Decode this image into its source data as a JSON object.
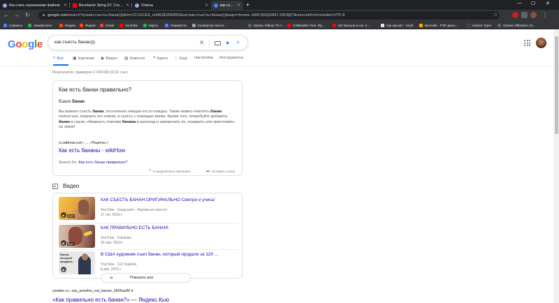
{
  "browser": {
    "tabs": [
      {
        "label": "Как слить ограничение файлов",
        "fav_color": "#8ab4f8"
      },
      {
        "label": "Benefactor String GT. Ставит на",
        "fav_color": "#ff0000"
      },
      {
        "label": "Ответы",
        "fav_color": "#8ab4f8"
      },
      {
        "label": "как съесть банан))) - Поиск в Go",
        "fav_color": "#4285f4"
      }
    ],
    "new_tab": "+",
    "window_controls": [
      "—",
      "☐",
      "✕"
    ],
    "url_host": "google.com",
    "url_rest": "/search?q=как+съесть+банан)))&rlz=1C1GCEA_enRE862RE862&oq=как+съесть+банан)))&aqs=chrome..69i57j0l2j0i30l7.2653j0j7&sourceid=chrome&ie=UTF-8",
    "bookmarks": [
      {
        "label": "Сервисы",
        "color": "#4285f4"
      },
      {
        "label": "Авиабилеты",
        "color": "#34a853"
      },
      {
        "label": "Яндекс",
        "color": "#fc3f1d"
      },
      {
        "label": "Яндекс",
        "color": "#fc3f1d"
      },
      {
        "label": "Gmail",
        "color": "#ea4335"
      },
      {
        "label": "YouTube",
        "color": "#ff0000"
      },
      {
        "label": "Карты",
        "color": "#34a853"
      },
      {
        "label": "Перевести",
        "color": "#4285f4"
      },
      {
        "label": "Конвертер тексто...",
        "color": "#9aa0a6"
      },
      {
        "label": "Купить Fallout 76 n...",
        "color": "#5f6368"
      },
      {
        "label": "Celldweller Feat. Sly...",
        "color": "#ff0000"
      },
      {
        "label": "Кот Бальни и хоз. 2...",
        "color": "#ff0000"
      },
      {
        "label": "Где маска? - Клуб",
        "color": "#e8eaed"
      },
      {
        "label": "Битлэйн - РЭР дены...",
        "color": "#f9ab00"
      },
      {
        "label": "Hacker Typer",
        "color": "#202124"
      },
      {
        "label": "Classic Offensive | B...",
        "color": "#5f6368"
      }
    ]
  },
  "google": {
    "logo": "Google",
    "query": "как съесть банан)))",
    "tabs": [
      {
        "label": "Все",
        "icon": "🔍"
      },
      {
        "label": "Картинки",
        "icon": "▣"
      },
      {
        "label": "Видео",
        "icon": "▶"
      },
      {
        "label": "Новости",
        "icon": "▤"
      },
      {
        "label": "Карты",
        "icon": "⌖"
      },
      {
        "label": "Ещё",
        "icon": "⋮"
      },
      {
        "label": "Настройки",
        "icon": ""
      },
      {
        "label": "Инструменты",
        "icon": ""
      }
    ],
    "stats": "Результатов: примерно 2 450 000 (0,62 сек.)",
    "snippet": {
      "title": "Как есть банан правильно?",
      "answer_prefix": "Ешьте ",
      "answer_bold": "банан",
      "answer_suffix": ".",
      "body": [
        {
          "t": "Вы можете съесть ",
          "b": false
        },
        {
          "t": "банан",
          "b": true
        },
        {
          "t": ", постепенно очищая его от кожуры. Также можно очистить ",
          "b": false
        },
        {
          "t": "банан",
          "b": true
        },
        {
          "t": " полностью, порезать его ножом, и съесть с помощью вилки. Кроме того, попробуйте добавить ",
          "b": false
        },
        {
          "t": "банан",
          "b": true
        },
        {
          "t": " в смузи, обмакнуть ломтики ",
          "b": false
        },
        {
          "t": "банана",
          "b": true
        },
        {
          "t": " в шоколад и заморозить их, пожарить или приготовить на гриле!",
          "b": false
        }
      ],
      "source": "ru.wikihow.com › ... › Рецепты",
      "source_more": "▾",
      "link": "Как есть бананы - wikiHow",
      "search_for_label": "Search for: ",
      "search_for_link": "Как есть банан правильно?"
    },
    "feedback": [
      {
        "label": "О выделенных описаниях",
        "icon": "?"
      },
      {
        "label": "Оставить отзыв",
        "icon": "▬"
      }
    ],
    "video_section": {
      "title": "Видео",
      "items": [
        {
          "title": "КАК СЪЕСТЬ БАНАН ОРИГИНАЛЬНО Смотри и учись!",
          "meta1": "YouTube · EasyLearn - Научиться просто!",
          "meta2": "17 окт. 2016 г.",
          "duration": "2:47"
        },
        {
          "title": "КАК ПРАВИЛЬНО ЕСТЬ БАНАН!",
          "meta1": "YouTube · Fairykiss",
          "meta2": "30 янв. 2019 г.",
          "duration": "0:17"
        },
        {
          "title": "В США художник съел банан, который продали за 120 ...",
          "meta1": "YouTube · 112 Україна",
          "meta2": "8 дек. 2019 г.",
          "duration": "",
          "thumb_text": "Банан, который продали..."
        }
      ],
      "show_all": "Показать все"
    },
    "next_result": {
      "url": "yandex.ru › как_pravilno_est_banan_0b56ae86 ▾",
      "title": "«Как правильно есть банан?» — Яндекс.Кью"
    }
  }
}
